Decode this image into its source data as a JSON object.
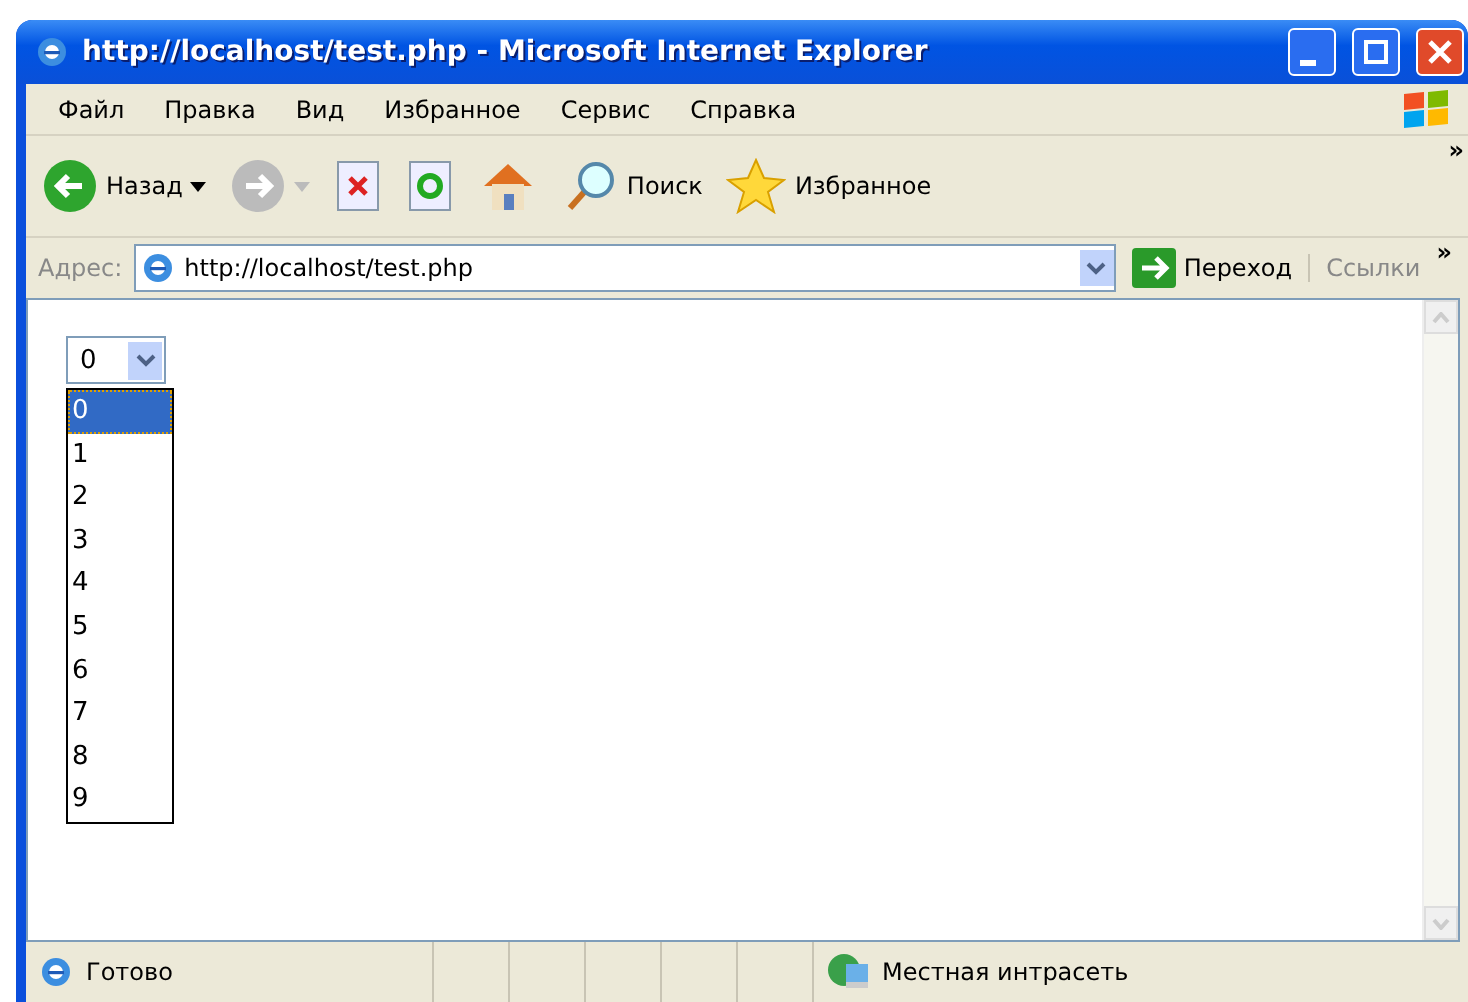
{
  "window": {
    "title": "http://localhost/test.php - Microsoft Internet Explorer"
  },
  "menu": [
    "Файл",
    "Правка",
    "Вид",
    "Избранное",
    "Сервис",
    "Справка"
  ],
  "toolbar": {
    "back": "Назад",
    "search": "Поиск",
    "favorites": "Избранное",
    "more": "»"
  },
  "address_bar": {
    "label": "Адрес:",
    "value": "http://localhost/test.php",
    "go": "Переход",
    "links": "Ссылки",
    "more": "»"
  },
  "select": {
    "value": "0",
    "expanded": true,
    "options": [
      {
        "label": "0",
        "selected": true
      },
      {
        "label": "1",
        "selected": false
      },
      {
        "label": "2",
        "selected": false
      },
      {
        "label": "3",
        "selected": false
      },
      {
        "label": "4",
        "selected": false
      },
      {
        "label": "5",
        "selected": false
      },
      {
        "label": "6",
        "selected": false
      },
      {
        "label": "7",
        "selected": false
      },
      {
        "label": "8",
        "selected": false
      },
      {
        "label": "9",
        "selected": false
      }
    ]
  },
  "status_bar": {
    "status": "Готово",
    "zone": "Местная интрасеть"
  }
}
